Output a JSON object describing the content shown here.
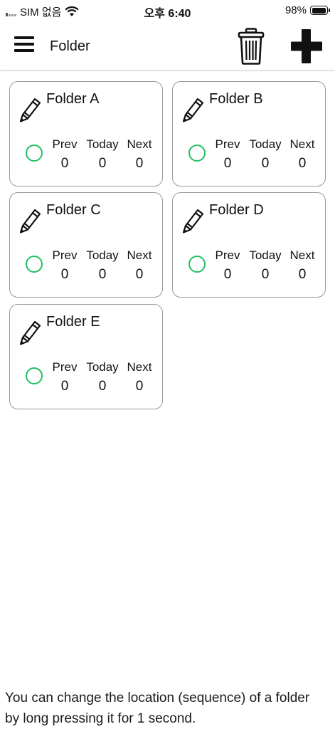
{
  "status_bar": {
    "carrier": "SIM 없음",
    "time": "오후 6:40",
    "battery_percent": "98%",
    "battery_level": 0.98
  },
  "header": {
    "title": "Folder",
    "menu_icon": "hamburger-menu-icon",
    "delete_icon": "trash-icon",
    "add_icon": "plus-icon"
  },
  "folders": [
    {
      "name": "Folder A",
      "prev_label": "Prev",
      "today_label": "Today",
      "next_label": "Next",
      "prev": "0",
      "today": "0",
      "next": "0"
    },
    {
      "name": "Folder B",
      "prev_label": "Prev",
      "today_label": "Today",
      "next_label": "Next",
      "prev": "0",
      "today": "0",
      "next": "0"
    },
    {
      "name": "Folder C",
      "prev_label": "Prev",
      "today_label": "Today",
      "next_label": "Next",
      "prev": "0",
      "today": "0",
      "next": "0"
    },
    {
      "name": "Folder D",
      "prev_label": "Prev",
      "today_label": "Today",
      "next_label": "Next",
      "prev": "0",
      "today": "0",
      "next": "0"
    },
    {
      "name": "Folder E",
      "prev_label": "Prev",
      "today_label": "Today",
      "next_label": "Next",
      "prev": "0",
      "today": "0",
      "next": "0"
    }
  ],
  "colors": {
    "status_ring": "#20c062",
    "card_border": "#9a9a9a"
  },
  "footer": {
    "hint": "You can change the location (sequence) of a folder by long pressing it for 1 second."
  }
}
